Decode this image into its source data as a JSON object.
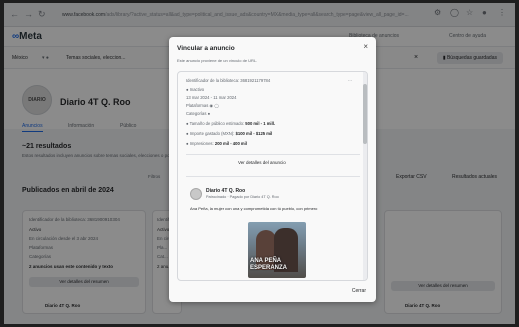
{
  "browser": {
    "url_host": "www.facebook.com",
    "url_rest": "/ads/library/?active_status=all&ad_type=political_and_issue_ads&country=MX&media_type=all&search_type=page&view_all_page_id=..."
  },
  "header": {
    "brand": "Meta",
    "links": [
      "Biblioteca de anuncios",
      "Centro de ayuda"
    ]
  },
  "filters": {
    "country": "México",
    "category": "Temas sociales, eleccion...",
    "save_label": "Búsquedas guardadas"
  },
  "page_profile": {
    "name": "Diario 4T Q. Roo",
    "avatar_text": "DIARIO",
    "tabs": [
      "Anuncios",
      "Información",
      "Público"
    ],
    "results": "~21 resultados",
    "results_note": "Estos resultados incluyen anuncios sobre temas sociales, elecciones o política.",
    "published": "Publicados en abril de 2024",
    "filters_label": "Filtros",
    "export_label": "Exportar CSV",
    "sort_label": "Resultados actuales"
  },
  "cards": [
    {
      "id": "Identificador de la biblioteca: 3681900910304",
      "status": "Activo",
      "date": "En circulación desde el 3 abr 2024",
      "platforms": "Plataformas",
      "category": "Categorías",
      "note": "2 anuncios usan este contenido y texto",
      "button": "Ver detalles del resumen",
      "advertiser": "Diario 4T Q. Roo"
    },
    {
      "id": "Identif...",
      "status": "Activo",
      "date": "En circ...",
      "platforms": "Pla...",
      "category": "Cat...",
      "note": "2 anu...",
      "button": "Ver detalles del resumen",
      "advertiser": "Diario 4T Q. Roo"
    }
  ],
  "modal": {
    "title": "Vincular a anuncio",
    "subtitle": "Este anuncio proviene de un vínculo de URL.",
    "ad_id": "Identificador de la biblioteca: 3681921179784",
    "status": "Inactivo",
    "dates": "13 mar 2024 - 11 mar 2024",
    "platforms": "Plataformas",
    "categories": "Categorías",
    "audience_label": "Tamaño de público estimado:",
    "audience_value": "500 mil - 1 mill.",
    "spend_label": "Importe gastado (MXN):",
    "spend_value": "$100 mil - $125 mil",
    "impressions_label": "Impresiones:",
    "impressions_value": "200 mil - 400 mil",
    "details_button": "Ver detalles del anuncio",
    "advertiser": "Diario 4T Q. Roo",
    "advertiser_sub": "Patrocinado · Pagado por Diario 4T Q. Roo",
    "body_text": "Ana Peña, la mujer con una y comprometida con tú pueblo, con primero",
    "image_text": "ANA PEÑA ESPERANZA",
    "close_label": "Cerrar"
  },
  "colors": {
    "accent": "#0866ff",
    "overlay": "rgba(0,0,0,0.45)"
  }
}
